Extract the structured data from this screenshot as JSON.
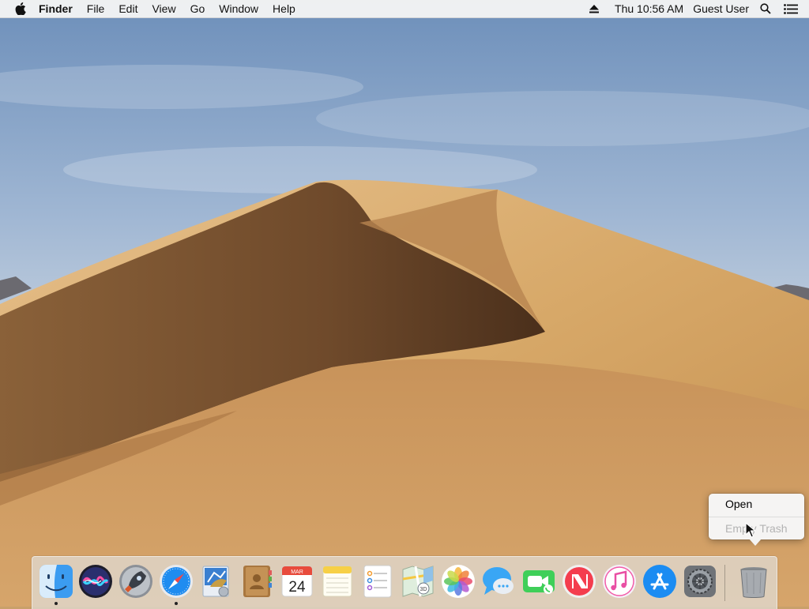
{
  "menubar": {
    "app_name": "Finder",
    "menus": [
      "File",
      "Edit",
      "View",
      "Go",
      "Window",
      "Help"
    ],
    "clock": "Thu 10:56 AM",
    "user": "Guest User",
    "icons": [
      "apple-icon",
      "eject-icon",
      "spotlight-search-icon",
      "notification-center-icon"
    ]
  },
  "dock": {
    "apps": [
      {
        "icon": "finder-icon",
        "running": true
      },
      {
        "icon": "siri-icon",
        "running": false
      },
      {
        "icon": "launchpad-icon",
        "running": false
      },
      {
        "icon": "safari-icon",
        "running": true
      },
      {
        "icon": "mail-icon",
        "running": false
      },
      {
        "icon": "contacts-icon",
        "running": false
      },
      {
        "icon": "calendar-icon",
        "running": false
      },
      {
        "icon": "notes-icon",
        "running": false
      },
      {
        "icon": "reminders-icon",
        "running": false
      },
      {
        "icon": "maps-icon",
        "running": false
      },
      {
        "icon": "photos-icon",
        "running": false
      },
      {
        "icon": "messages-icon",
        "running": false
      },
      {
        "icon": "facetime-icon",
        "running": false
      },
      {
        "icon": "news-icon",
        "running": false
      },
      {
        "icon": "itunes-icon",
        "running": false
      },
      {
        "icon": "app-store-icon",
        "running": false
      },
      {
        "icon": "system-preferences-icon",
        "running": false
      },
      {
        "icon": "trash-icon",
        "running": false
      }
    ],
    "calendar": {
      "month": "MAR",
      "day": "24"
    }
  },
  "context_menu": {
    "items": [
      {
        "label": "Open",
        "enabled": true
      },
      {
        "label": "Empty Trash",
        "enabled": false
      }
    ]
  }
}
